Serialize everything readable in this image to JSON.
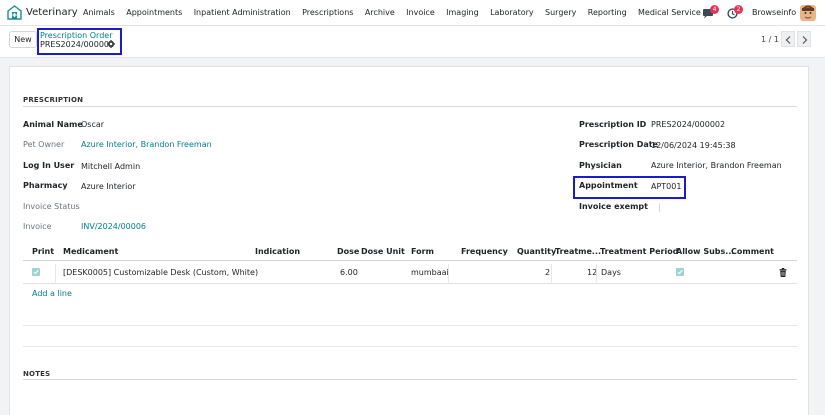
{
  "navbar": {
    "app_name": "Veterinary",
    "menu": [
      "Animals",
      "Appointments",
      "Inpatient Administration",
      "Prescriptions",
      "Archive",
      "Invoice",
      "Imaging",
      "Laboratory",
      "Surgery",
      "Reporting",
      "Medical Service"
    ],
    "chat_count": "4",
    "activity_count": "2",
    "company": "Browseinfo"
  },
  "control": {
    "new_label": "New",
    "breadcrumb_parent": "Prescription Order",
    "breadcrumb_current": "PRES2024/000002",
    "pager": "1 / 1"
  },
  "form": {
    "section_title": "PRESCRIPTION",
    "left": {
      "animal_name_label": "Animal Name",
      "animal_name": "Oscar",
      "pet_owner_label": "Pet Owner",
      "pet_owner": "Azure Interior, Brandon Freeman",
      "login_user_label": "Log In User",
      "login_user": "Mitchell Admin",
      "pharmacy_label": "Pharmacy",
      "pharmacy": "Azure Interior",
      "invoice_status_label": "Invoice Status",
      "invoice_status": "",
      "invoice_label": "Invoice",
      "invoice": "INV/2024/00006"
    },
    "right": {
      "prescription_id_label": "Prescription ID",
      "prescription_id": "PRES2024/000002",
      "prescription_date_label": "Prescription Date",
      "prescription_date": "12/06/2024 19:45:38",
      "physician_label": "Physician",
      "physician": "Azure Interior, Brandon Freeman",
      "appointment_label": "Appointment",
      "appointment": "APT001",
      "invoice_exempt_label": "Invoice exempt"
    }
  },
  "table": {
    "headers": {
      "print": "Print",
      "medicament": "Medicament",
      "indication": "Indication",
      "dose": "Dose",
      "dose_unit": "Dose Unit",
      "form": "Form",
      "frequency": "Frequency",
      "quantity": "Quantity",
      "treatment": "Treatme...",
      "treatment_period": "Treatment Period",
      "allow_subs": "Allow Subs...",
      "comment": "Comment"
    },
    "rows": [
      {
        "print": true,
        "medicament": "[DESK0005] Customizable Desk (Custom, White)",
        "indication": "",
        "dose": "6.00",
        "dose_unit": "",
        "form": "mumbaai",
        "frequency": "",
        "quantity": "2",
        "treatment": "12",
        "treatment_period": "Days",
        "allow_subs": true,
        "comment": ""
      }
    ],
    "add_line": "Add a line"
  },
  "notes": {
    "section_title": "NOTES"
  },
  "colors": {
    "accent": "#017e84",
    "highlight_box": "#1b1bcc",
    "badge": "#e3365a"
  }
}
